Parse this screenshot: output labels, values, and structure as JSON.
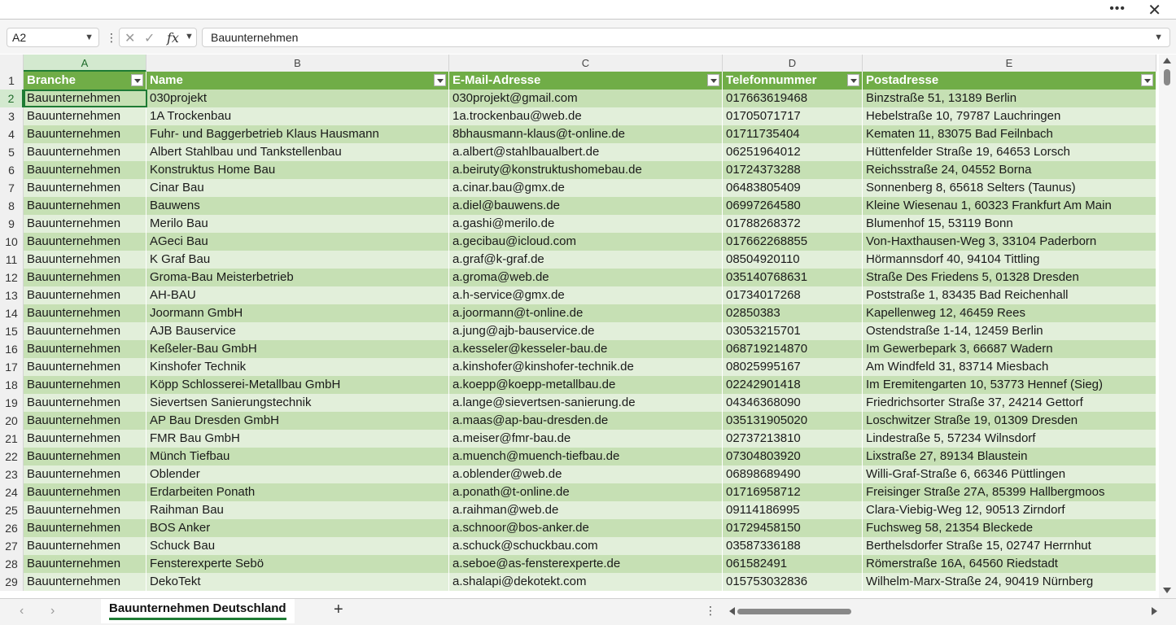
{
  "window": {
    "more_label": "•••",
    "close_label": "✕"
  },
  "formula_bar": {
    "name_box": "A2",
    "formula": "Bauunternehmen",
    "fx_label": "fx"
  },
  "columns": [
    "A",
    "B",
    "C",
    "D",
    "E"
  ],
  "headers": [
    "Branche",
    "Name",
    "E-Mail-Adresse",
    "Telefonnummer",
    "Postadresse"
  ],
  "rows": [
    {
      "num": "2",
      "cells": [
        "Bauunternehmen",
        "030projekt",
        "030projekt@gmail.com",
        "017663619468",
        "Binzstraße 51, 13189 Berlin"
      ]
    },
    {
      "num": "3",
      "cells": [
        "Bauunternehmen",
        "1A Trockenbau",
        "1a.trockenbau@web.de",
        "01705071717",
        "Hebelstraße 10, 79787 Lauchringen"
      ]
    },
    {
      "num": "4",
      "cells": [
        "Bauunternehmen",
        "Fuhr- und Baggerbetrieb Klaus Hausmann",
        "8bhausmann-klaus@t-online.de",
        "01711735404",
        "Kematen 11, 83075 Bad Feilnbach"
      ]
    },
    {
      "num": "5",
      "cells": [
        "Bauunternehmen",
        "Albert Stahlbau und Tankstellenbau",
        "a.albert@stahlbaualbert.de",
        "06251964012",
        "Hüttenfelder Straße 19, 64653 Lorsch"
      ]
    },
    {
      "num": "6",
      "cells": [
        "Bauunternehmen",
        "Konstruktus Home Bau",
        "a.beiruty@konstruktushomebau.de",
        "01724373288",
        "Reichsstraße 24, 04552 Borna"
      ]
    },
    {
      "num": "7",
      "cells": [
        "Bauunternehmen",
        "Cinar Bau",
        "a.cinar.bau@gmx.de",
        "06483805409",
        "Sonnenberg 8, 65618 Selters (Taunus)"
      ]
    },
    {
      "num": "8",
      "cells": [
        "Bauunternehmen",
        "Bauwens",
        "a.diel@bauwens.de",
        "06997264580",
        "Kleine Wiesenau 1, 60323 Frankfurt Am Main"
      ]
    },
    {
      "num": "9",
      "cells": [
        "Bauunternehmen",
        "Merilo Bau",
        "a.gashi@merilo.de",
        "01788268372",
        "Blumenhof 15, 53119 Bonn"
      ]
    },
    {
      "num": "10",
      "cells": [
        "Bauunternehmen",
        "AGeci Bau",
        "a.gecibau@icloud.com",
        "017662268855",
        "Von-Haxthausen-Weg 3, 33104 Paderborn"
      ]
    },
    {
      "num": "11",
      "cells": [
        "Bauunternehmen",
        "K Graf Bau",
        "a.graf@k-graf.de",
        "08504920110",
        "Hörmannsdorf 40, 94104 Tittling"
      ]
    },
    {
      "num": "12",
      "cells": [
        "Bauunternehmen",
        "Groma-Bau Meisterbetrieb",
        "a.groma@web.de",
        "035140768631",
        "Straße Des Friedens 5, 01328 Dresden"
      ]
    },
    {
      "num": "13",
      "cells": [
        "Bauunternehmen",
        "AH-BAU",
        "a.h-service@gmx.de",
        "01734017268",
        "Poststraße 1, 83435 Bad Reichenhall"
      ]
    },
    {
      "num": "14",
      "cells": [
        "Bauunternehmen",
        "Joormann GmbH",
        "a.joormann@t-online.de",
        "02850383",
        "Kapellenweg 12, 46459 Rees"
      ]
    },
    {
      "num": "15",
      "cells": [
        "Bauunternehmen",
        "AJB Bauservice",
        "a.jung@ajb-bauservice.de",
        "03053215701",
        "Ostendstraße 1-14, 12459 Berlin"
      ]
    },
    {
      "num": "16",
      "cells": [
        "Bauunternehmen",
        "Keßeler-Bau GmbH",
        "a.kesseler@kesseler-bau.de",
        "068719214870",
        "Im Gewerbepark 3, 66687 Wadern"
      ]
    },
    {
      "num": "17",
      "cells": [
        "Bauunternehmen",
        "Kinshofer Technik",
        "a.kinshofer@kinshofer-technik.de",
        "08025995167",
        "Am Windfeld 31, 83714 Miesbach"
      ]
    },
    {
      "num": "18",
      "cells": [
        "Bauunternehmen",
        "Köpp Schlosserei-Metallbau GmbH",
        "a.koepp@koepp-metallbau.de",
        "02242901418",
        "Im Eremitengarten 10, 53773 Hennef (Sieg)"
      ]
    },
    {
      "num": "19",
      "cells": [
        "Bauunternehmen",
        "Sievertsen Sanierungstechnik",
        "a.lange@sievertsen-sanierung.de",
        "04346368090",
        "Friedrichsorter Straße 37, 24214 Gettorf"
      ]
    },
    {
      "num": "20",
      "cells": [
        "Bauunternehmen",
        "AP Bau Dresden GmbH",
        "a.maas@ap-bau-dresden.de",
        "035131905020",
        "Loschwitzer Straße 19, 01309 Dresden"
      ]
    },
    {
      "num": "21",
      "cells": [
        "Bauunternehmen",
        "FMR Bau GmbH",
        "a.meiser@fmr-bau.de",
        "02737213810",
        "Lindestraße 5, 57234 Wilnsdorf"
      ]
    },
    {
      "num": "22",
      "cells": [
        "Bauunternehmen",
        "Münch Tiefbau",
        "a.muench@muench-tiefbau.de",
        "07304803920",
        "Lixstraße 27, 89134 Blaustein"
      ]
    },
    {
      "num": "23",
      "cells": [
        "Bauunternehmen",
        "Oblender",
        "a.oblender@web.de",
        "06898689490",
        "Willi-Graf-Straße 6, 66346 Püttlingen"
      ]
    },
    {
      "num": "24",
      "cells": [
        "Bauunternehmen",
        "Erdarbeiten Ponath",
        "a.ponath@t-online.de",
        "01716958712",
        "Freisinger Straße 27A, 85399 Hallbergmoos"
      ]
    },
    {
      "num": "25",
      "cells": [
        "Bauunternehmen",
        "Raihman Bau",
        "a.raihman@web.de",
        "09114186995",
        "Clara-Viebig-Weg 12, 90513 Zirndorf"
      ]
    },
    {
      "num": "26",
      "cells": [
        "Bauunternehmen",
        "BOS Anker",
        "a.schnoor@bos-anker.de",
        "01729458150",
        "Fuchsweg 58, 21354 Bleckede"
      ]
    },
    {
      "num": "27",
      "cells": [
        "Bauunternehmen",
        "Schuck Bau",
        "a.schuck@schuckbau.com",
        "03587336188",
        "Berthelsdorfer Straße 15, 02747 Herrnhut"
      ]
    },
    {
      "num": "28",
      "cells": [
        "Bauunternehmen",
        "Fensterexperte Sebö",
        "a.seboe@as-fensterexperte.de",
        "061582491",
        "Römerstraße 16A, 64560 Riedstadt"
      ]
    },
    {
      "num": "29",
      "cells": [
        "Bauunternehmen",
        "DekoTekt",
        "a.shalapi@dekotekt.com",
        "015753032836",
        "Wilhelm-Marx-Straße 24, 90419 Nürnberg"
      ]
    }
  ],
  "sheet_tab": "Bauunternehmen Deutschland",
  "add_sheet_label": "+",
  "colors": {
    "header_green": "#70ad47",
    "band_dark": "#c6e0b4",
    "band_light": "#e2efda",
    "accent": "#1e7b34"
  }
}
